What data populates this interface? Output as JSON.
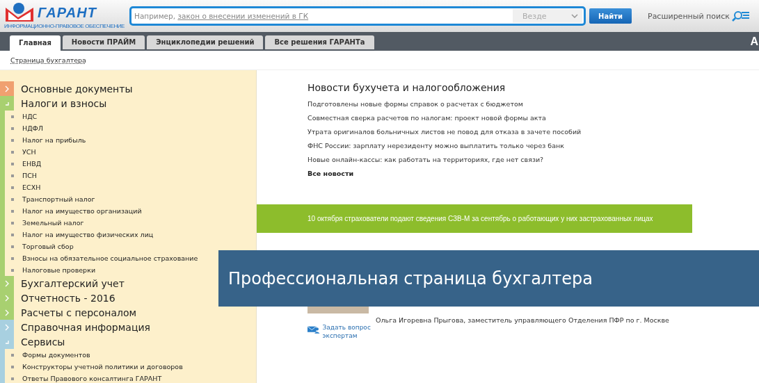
{
  "logo": {
    "name": "ГАРАНТ",
    "tagline": "ИНФОРМАЦИОННО-ПРАВОВОЕ ОБЕСПЕЧЕНИЕ"
  },
  "search": {
    "placeholder_prefix": "Например, ",
    "placeholder_link": "закон о внесении изменений в ГК",
    "scope": "Везде",
    "button": "Найти",
    "advanced": "Расширенный поиск"
  },
  "tabs": [
    {
      "label": "Главная",
      "selected": true
    },
    {
      "label": "Новости ПРАЙМ",
      "selected": false
    },
    {
      "label": "Энциклопедии решений",
      "selected": false
    },
    {
      "label": "Все решения ГАРАНТа",
      "selected": false
    }
  ],
  "tabbar_edge_text": "А",
  "breadcrumb": "Страница бухгалтера",
  "sidebar": {
    "sections": [
      {
        "title": "Основные документы",
        "color": "#f0a070",
        "expanded": false
      },
      {
        "title": "Налоги и взносы",
        "color": "#a8d070",
        "expanded": true,
        "children": [
          "НДС",
          "НДФЛ",
          "Налог на прибыль",
          "УСН",
          "ЕНВД",
          "ПСН",
          "ЕСХН",
          "Транспортный налог",
          "Налог на имущество организаций",
          "Земельный налог",
          "Налог на имущество физических лиц",
          "Торговый сбор",
          "Взносы на обязательное социальное страхование",
          "Налоговые проверки"
        ]
      },
      {
        "title": "Бухгалтерский учет",
        "color": "#a8d070",
        "expanded": false
      },
      {
        "title": "Отчетность - 2016",
        "color": "#a8d070",
        "expanded": false
      },
      {
        "title": "Расчеты с персоналом",
        "color": "#a8d070",
        "expanded": false
      },
      {
        "title": "Справочная информация",
        "color": "#a8d0e0",
        "expanded": false
      },
      {
        "title": "Сервисы",
        "color": "#a8d0e0",
        "expanded": true,
        "children": [
          "Формы документов",
          "Конструкторы учетной политики и договоров",
          "Ответы Правового консалтинга ГАРАНТ"
        ]
      }
    ]
  },
  "news": {
    "title": "Новости бухучета и налогообложения",
    "items": [
      "Подготовлены новые формы справок о расчетах с бюджетом",
      "Совместная сверка расчетов по налогам: проект новой формы акта",
      "Утрата оригиналов больничных листов не повод для отказа в зачете пособий",
      "ФНС России: зарплату нерезиденту можно выплатить только через банк",
      "Новые онлайн-кассы: как работать на территориях, где нет связи?"
    ],
    "all": "Все новости"
  },
  "announcement": "10 октября страхователи подают сведения СЗВ-М за сентябрь о работающих у них застрахованных лицах",
  "recommendation": {
    "author": "Ольга Игоревна Прыгова, заместитель управляющего Отделения ПФР по г. Москве",
    "ask": "Задать вопрос экспертам"
  },
  "overlay_banner": "Профессиональная страница бухгалтера"
}
